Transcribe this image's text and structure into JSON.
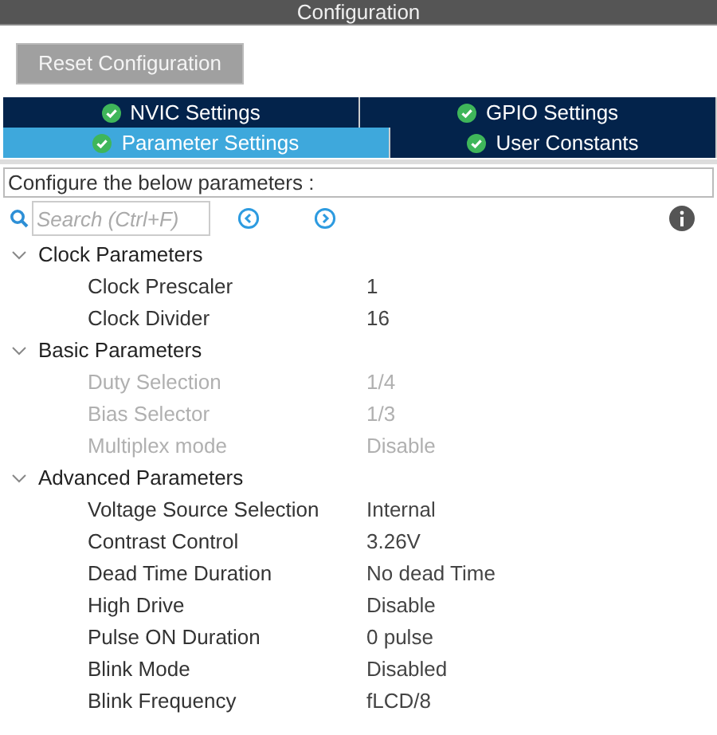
{
  "window": {
    "title": "Configuration"
  },
  "reset_button": "Reset Configuration",
  "tabs": [
    [
      {
        "label": "NVIC Settings",
        "selected": false
      },
      {
        "label": "GPIO Settings",
        "selected": false
      }
    ],
    [
      {
        "label": "Parameter Settings",
        "selected": true
      },
      {
        "label": "User Constants",
        "selected": false
      }
    ]
  ],
  "instruction": "Configure the below parameters :",
  "search": {
    "placeholder": "Search (Ctrl+F)"
  },
  "groups": [
    {
      "label": "Clock Parameters",
      "expanded": true,
      "children": [
        {
          "name": "Clock Prescaler",
          "value": "1",
          "disabled": false
        },
        {
          "name": "Clock Divider",
          "value": "16",
          "disabled": false
        }
      ]
    },
    {
      "label": "Basic Parameters",
      "expanded": true,
      "children": [
        {
          "name": "Duty Selection",
          "value": "1/4",
          "disabled": true
        },
        {
          "name": "Bias Selector",
          "value": "1/3",
          "disabled": true
        },
        {
          "name": "Multiplex mode",
          "value": "Disable",
          "disabled": true
        }
      ]
    },
    {
      "label": "Advanced Parameters",
      "expanded": true,
      "children": [
        {
          "name": "Voltage Source Selection",
          "value": "Internal",
          "disabled": false
        },
        {
          "name": "Contrast Control",
          "value": "3.26V",
          "disabled": false
        },
        {
          "name": "Dead Time Duration",
          "value": "No dead Time",
          "disabled": false
        },
        {
          "name": "High Drive",
          "value": "Disable",
          "disabled": false
        },
        {
          "name": "Pulse ON Duration",
          "value": "0 pulse",
          "disabled": false
        },
        {
          "name": "Blink Mode",
          "value": "Disabled",
          "disabled": false
        },
        {
          "name": "Blink Frequency",
          "value": "fLCD/8",
          "disabled": false
        }
      ]
    }
  ]
}
